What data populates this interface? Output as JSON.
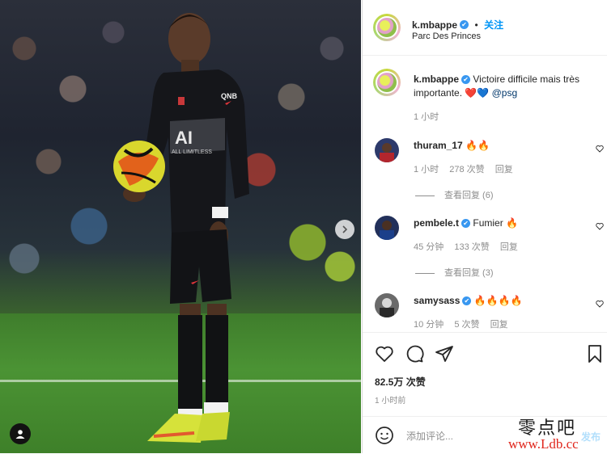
{
  "header": {
    "username": "k.mbappe",
    "follow_label": "关注",
    "location": "Parc Des Princes",
    "bullet": "•"
  },
  "caption": {
    "username": "k.mbappe",
    "text": "Victoire difficile mais très importante.",
    "emojis": "❤️💙",
    "mention": "@psg",
    "time": "1 小时"
  },
  "comments": [
    {
      "username": "thuram_17",
      "text": "🔥🔥",
      "time": "1 小时",
      "likes": "278 次赞",
      "reply_label": "回复",
      "view_replies": "查看回复 (6)"
    },
    {
      "username": "pembele.t",
      "text": "Fumier 🔥",
      "time": "45 分钟",
      "likes": "133 次赞",
      "reply_label": "回复",
      "view_replies": "查看回复 (3)"
    },
    {
      "username": "samysass",
      "text": "🔥🔥🔥🔥",
      "time": "10 分钟",
      "likes": "5 次赞",
      "reply_label": "回复"
    }
  ],
  "actions": {
    "likes": "82.5万 次赞",
    "posted": "1 小时前"
  },
  "add_comment": {
    "placeholder": "添加评论...",
    "post_label": "发布"
  },
  "photo": {
    "jersey_sponsor": "QNB",
    "jersey_text": "ALL LIMITLESS"
  },
  "watermark": {
    "top": "零点吧",
    "bottom": "www.Ldb.cc"
  },
  "colors": {
    "link_blue": "#0095f6",
    "verified_blue": "#3897f0",
    "muted": "#8e8e8e",
    "text": "#262626"
  }
}
